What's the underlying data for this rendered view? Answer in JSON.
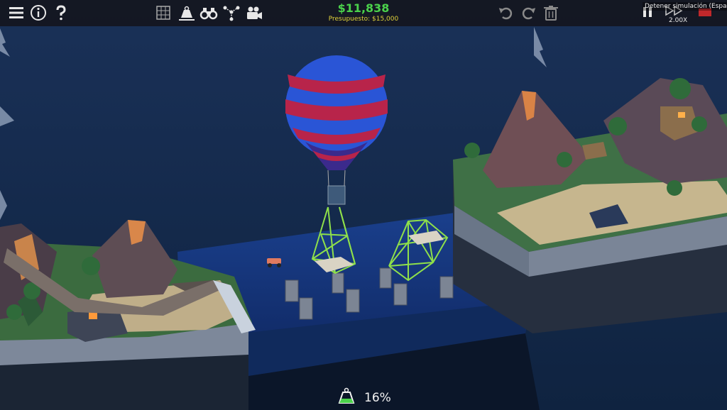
{
  "hud": {
    "budget": {
      "money": "$11,838",
      "label": "Presupuesto: $15,000"
    },
    "simulation": {
      "tooltip": "Detener simulación (Espacio)",
      "speed": "2.00X"
    },
    "stress": {
      "value": "16%"
    }
  },
  "icons": {
    "left": [
      "menu-icon",
      "info-icon",
      "help-icon"
    ],
    "tools": [
      "grid-icon",
      "weight-load-icon",
      "binoculars-icon",
      "graph-icon",
      "camera-icon"
    ],
    "edit": [
      "undo-icon",
      "redo-icon",
      "trash-icon"
    ],
    "sim": [
      "pause-icon",
      "fast-forward-icon",
      "flag-icon"
    ]
  },
  "colors": {
    "money": "#4bd24b",
    "budget_label": "#e0d23a",
    "bridge_beams": "#8fe04a",
    "balloon_blue": "#2a55d6",
    "balloon_red": "#b8244a",
    "water": "#15367a"
  }
}
